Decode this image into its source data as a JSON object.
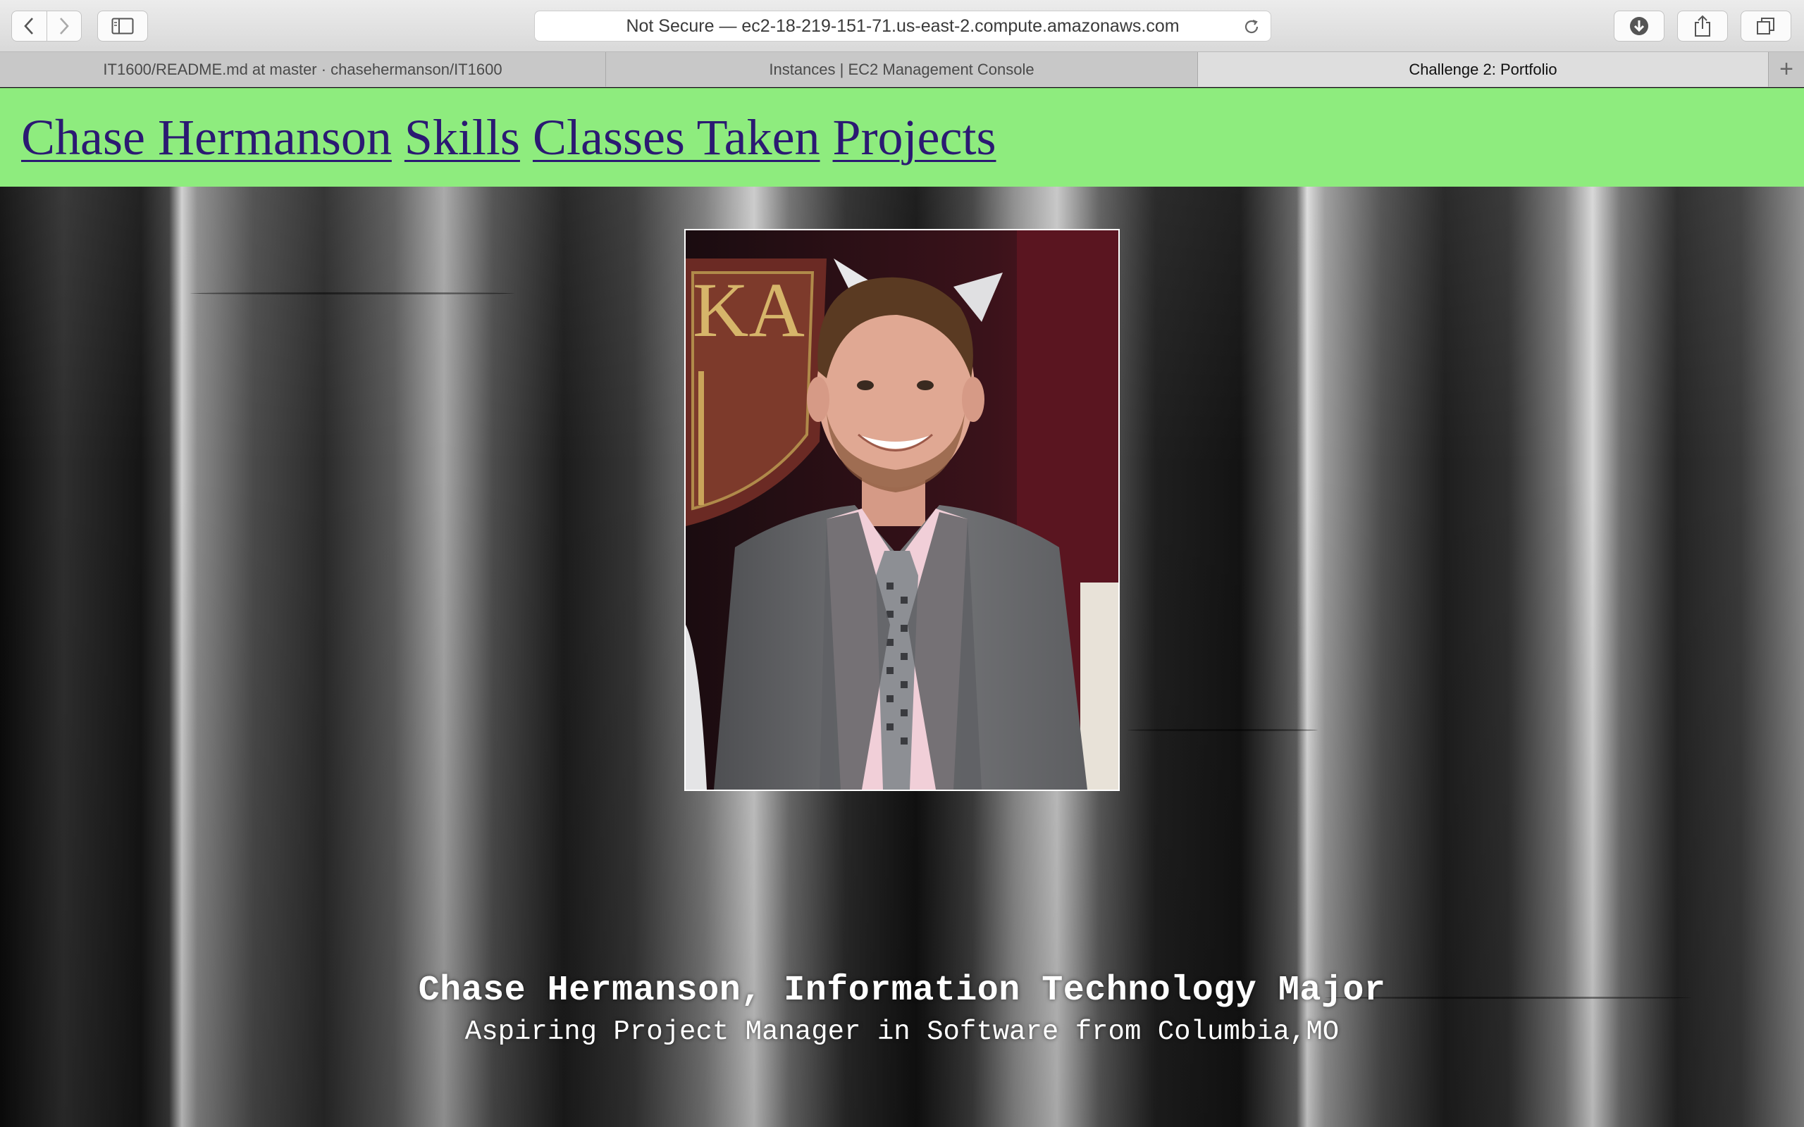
{
  "browser": {
    "address_text": "Not Secure — ec2-18-219-151-71.us-east-2.compute.amazonaws.com",
    "tabs": [
      {
        "label": "IT1600/README.md at master · chasehermanson/IT1600"
      },
      {
        "label": "Instances | EC2 Management Console"
      },
      {
        "label": "Challenge 2: Portfolio"
      }
    ],
    "new_tab_label": "+"
  },
  "nav": {
    "links": [
      "Chase Hermanson",
      "Skills",
      "Classes Taken",
      "Projects"
    ]
  },
  "hero": {
    "heading": "Chase Hermanson, Information Technology Major",
    "subheading": "Aspiring Project Manager in Software from Columbia,MO",
    "photo_icon": "portrait-photo"
  },
  "colors": {
    "navbar_bg": "#8eec7e",
    "link_color": "#2b1a72",
    "text_color": "#ffffff"
  }
}
